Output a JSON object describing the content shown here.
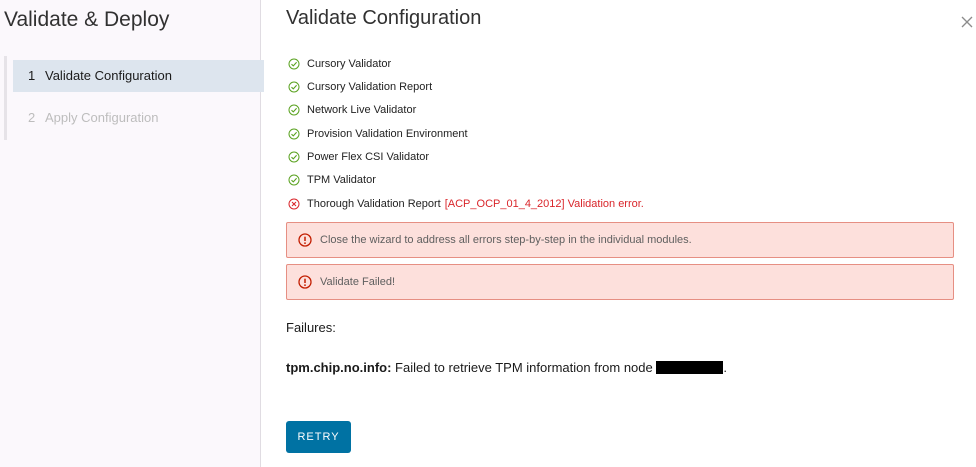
{
  "sidebar": {
    "title": "Validate & Deploy",
    "steps": [
      {
        "number": "1",
        "label": "Validate Configuration",
        "state": "active"
      },
      {
        "number": "2",
        "label": "Apply Configuration",
        "state": "disabled"
      }
    ]
  },
  "main": {
    "title": "Validate Configuration",
    "close_icon": "close-icon",
    "checks": [
      {
        "label": "Cursory Validator",
        "status": "success"
      },
      {
        "label": "Cursory Validation Report",
        "status": "success"
      },
      {
        "label": "Network Live Validator",
        "status": "success"
      },
      {
        "label": "Provision Validation Environment",
        "status": "success"
      },
      {
        "label": "Power Flex CSI Validator",
        "status": "success"
      },
      {
        "label": "TPM Validator",
        "status": "success"
      },
      {
        "label": "Thorough Validation Report",
        "status": "error",
        "error_text": "[ACP_OCP_01_4_2012] Validation error."
      }
    ],
    "alerts": [
      {
        "text": "Close the wizard to address all errors step-by-step in the individual modules."
      },
      {
        "text": "Validate Failed!"
      }
    ],
    "failures_label": "Failures:",
    "failure": {
      "key": "tpm.chip.no.info:",
      "message": "Failed to retrieve TPM information from node",
      "suffix": "."
    },
    "retry_label": "RETRY"
  },
  "colors": {
    "success": "#5aa220",
    "error": "#d9262b",
    "alert_bg": "#fde0dc",
    "alert_border": "#e68f83",
    "alert_icon": "#c21d00",
    "primary_button": "#0072a3",
    "active_step_bg": "#dde5ee"
  }
}
